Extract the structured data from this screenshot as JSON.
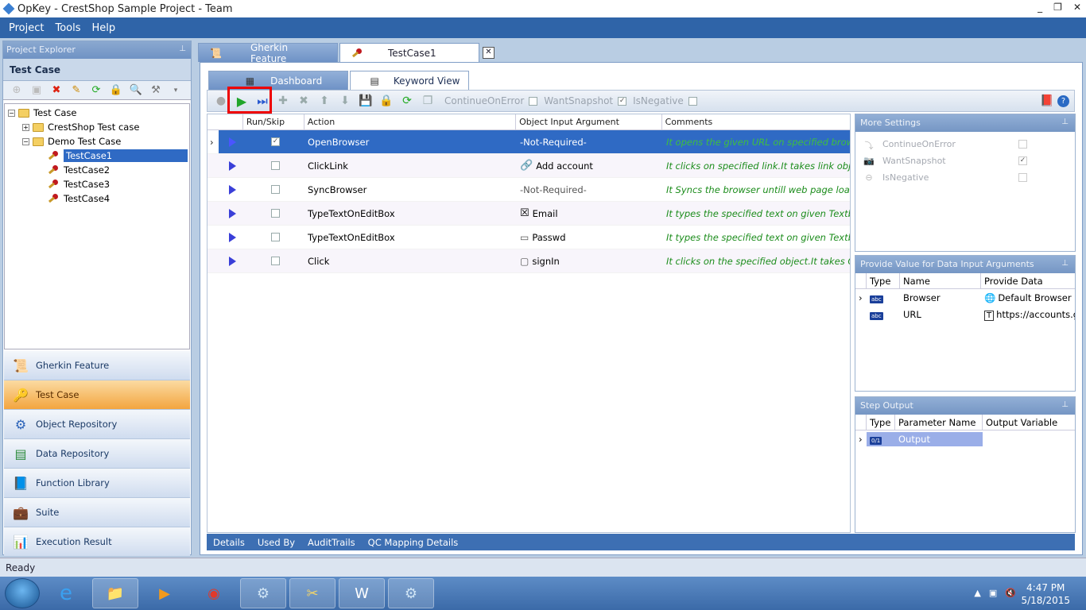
{
  "window": {
    "title": "OpKey - CrestShop Sample Project - Team",
    "controls": [
      "_",
      "❐",
      "✕"
    ]
  },
  "menu": [
    "Project",
    "Tools",
    "Help"
  ],
  "project_explorer": {
    "header": "Project Explorer",
    "section": "Test Case",
    "tree": {
      "root": "Test Case",
      "children": [
        {
          "label": "CrestShop Test case"
        },
        {
          "label": "Demo Test Case",
          "items": [
            "TestCase1",
            "TestCase2",
            "TestCase3",
            "TestCase4"
          ]
        }
      ]
    },
    "nav": [
      "Gherkin Feature",
      "Test Case",
      "Object Repository",
      "Data Repository",
      "Function Library",
      "Suite",
      "Execution Result"
    ]
  },
  "doc_tabs": [
    {
      "label": "Gherkin Feature"
    },
    {
      "label": "TestCase1"
    }
  ],
  "sub_tabs": [
    "Dashboard",
    "Keyword View"
  ],
  "toolbar": {
    "continue_on_error": "ContinueOnError",
    "want_snapshot": "WantSnapshot",
    "is_negative": "IsNegative"
  },
  "grid": {
    "headers": [
      "Run/Skip",
      "Action",
      "Object Input Argument",
      "Comments"
    ],
    "rows": [
      {
        "run": true,
        "action": "OpenBrowser",
        "object": "-Not-Required-",
        "comment": "It opens the given URL on specified browse..."
      },
      {
        "run": false,
        "action": "ClickLink",
        "object": "Add account",
        "comment": "It clicks on specified link.It takes link object a..."
      },
      {
        "run": false,
        "action": "SyncBrowser",
        "object": "-Not-Required-",
        "comment": "It Syncs the browser untill web page loads pr..."
      },
      {
        "run": false,
        "action": "TypeTextOnEditBox",
        "object": "Email",
        "comment": "It types the specified text on given Textbo..."
      },
      {
        "run": false,
        "action": "TypeTextOnEditBox",
        "object": "Passwd",
        "comment": "It types the specified text on given Textbo..."
      },
      {
        "run": false,
        "action": "Click",
        "object": "signIn",
        "comment": "It clicks on the specified object.It takes OR o..."
      }
    ],
    "footer_tabs": [
      "Details",
      "Used By",
      "AuditTrails",
      "QC Mapping Details"
    ]
  },
  "more_settings": {
    "title": "More Settings",
    "items": [
      {
        "label": "ContinueOnError",
        "checked": false
      },
      {
        "label": "WantSnapshot",
        "checked": true
      },
      {
        "label": "IsNegative",
        "checked": false
      }
    ]
  },
  "data_input": {
    "title": "Provide Value for Data Input Arguments",
    "headers": [
      "Type",
      "Name",
      "Provide Data"
    ],
    "rows": [
      {
        "name": "Browser",
        "value": "Default Browser"
      },
      {
        "name": "URL",
        "value": "https://accounts.go"
      }
    ],
    "type_label": "abc"
  },
  "step_output": {
    "title": "Step Output",
    "headers": [
      "Type",
      "Parameter Name",
      "Output Variable"
    ],
    "rows": [
      {
        "type": "0/1",
        "name": "Output",
        "variable": ""
      }
    ]
  },
  "status": "Ready",
  "clock": {
    "time": "4:47 PM",
    "date": "5/18/2015"
  }
}
